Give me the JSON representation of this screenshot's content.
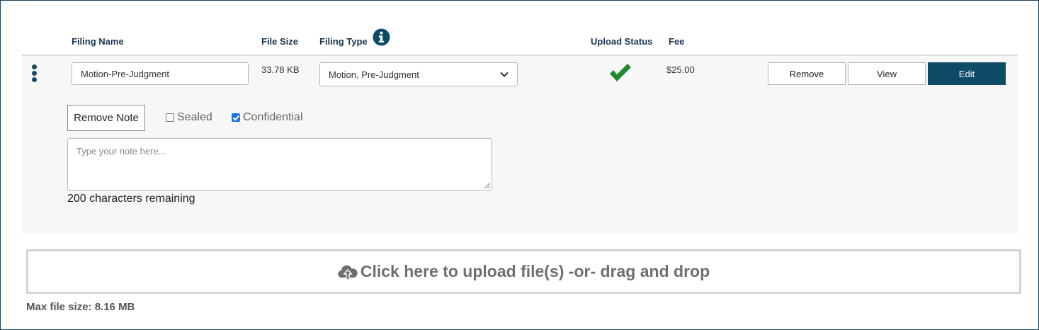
{
  "headers": {
    "filing_name": "Filing Name",
    "file_size": "File Size",
    "filing_type": "Filing Type",
    "upload_status": "Upload Status",
    "fee": "Fee"
  },
  "filing": {
    "name_value": "Motion-Pre-Judgment",
    "file_size": "33.78 KB",
    "filing_type_selected": "Motion, Pre-Judgment",
    "upload_status": "success",
    "fee": "$25.00"
  },
  "actions": {
    "remove_label": "Remove",
    "view_label": "View",
    "edit_label": "Edit"
  },
  "note": {
    "remove_note_label": "Remove Note",
    "sealed_label": "Sealed",
    "sealed_checked": false,
    "confidential_label": "Confidential",
    "confidential_checked": true,
    "placeholder": "Type your note here...",
    "remaining": "200 characters remaining"
  },
  "upload": {
    "drop_label": "Click here to upload file(s) -or- drag and drop",
    "max_size": "Max file size: 8.16 MB"
  },
  "icons": {
    "info": "info-circle-icon",
    "status": "checkmark-icon",
    "upload": "cloud-upload-icon",
    "menu": "kebab-menu-icon"
  },
  "colors": {
    "primary": "#0d4a66",
    "header_text": "#1b3550",
    "success": "#1e8a2e",
    "checkbox": "#1a73e8"
  }
}
